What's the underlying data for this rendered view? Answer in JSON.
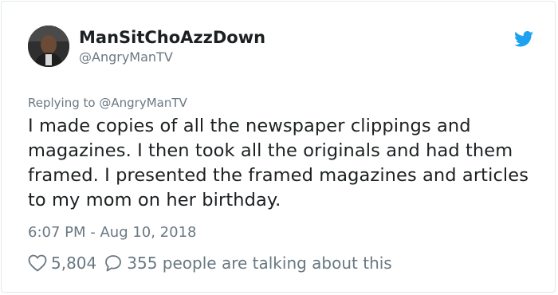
{
  "author": {
    "display_name": "ManSitChoAzzDown",
    "handle": "@AngryManTV"
  },
  "replying_to": {
    "prefix": "Replying to",
    "mention": "@AngryManTV"
  },
  "tweet": {
    "text": "I made copies of all the newspaper clippings and magazines. I then took all the originals and had them framed. I presented the framed magazines and articles to my mom on her birthday.",
    "timestamp": "6:07 PM - Aug 10, 2018"
  },
  "engagement": {
    "likes": "5,804",
    "conversation": "355 people are talking about this"
  },
  "icons": {
    "brand": "twitter-bird-icon",
    "like": "heart-icon",
    "reply": "speech-bubble-icon"
  },
  "colors": {
    "brand_blue": "#1da1f2",
    "text_primary": "#1c2022",
    "text_secondary": "#697882",
    "border": "#e1e8ed"
  }
}
